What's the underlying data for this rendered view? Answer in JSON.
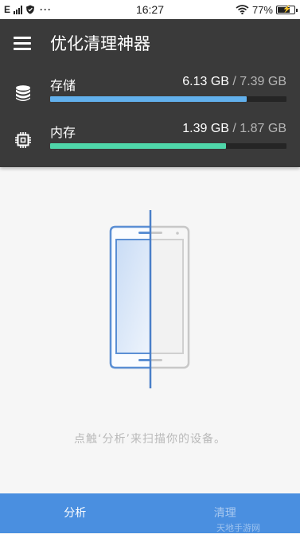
{
  "status_bar": {
    "carrier": "E",
    "dots": "···",
    "time": "16:27",
    "battery_percent": "77%",
    "battery_level": 0.77
  },
  "header": {
    "title": "优化清理神器",
    "storage": {
      "label": "存储",
      "used": "6.13 GB",
      "separator": " / ",
      "total": "7.39 GB",
      "fraction": 0.83,
      "color": "#62b0ec",
      "icon": "database-icon"
    },
    "memory": {
      "label": "内存",
      "used": "1.39 GB",
      "separator": " / ",
      "total": "1.87 GB",
      "fraction": 0.743,
      "color": "#4fd6a9",
      "icon": "chip-icon"
    }
  },
  "main": {
    "hint": "点触‘分析’来扫描你的设备。",
    "illustration": "phone-scan-icon"
  },
  "bottom_bar": {
    "tabs": [
      {
        "label": "分析",
        "active": true
      },
      {
        "label": "清理",
        "active": false
      }
    ],
    "watermark": "天地手游网",
    "color": "#4a8fe0"
  }
}
